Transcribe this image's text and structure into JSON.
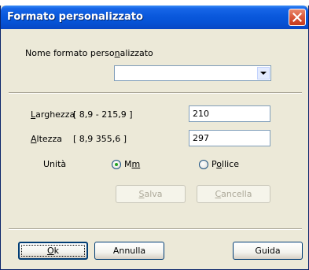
{
  "window": {
    "title": "Formato personalizzato"
  },
  "format_name": {
    "label_pre": "Nome formato perso",
    "label_accel": "n",
    "label_post": "alizzato",
    "value": ""
  },
  "width": {
    "label_accel": "L",
    "label_post": "arghezza",
    "range": "[ 8,9 -  215,9 ]",
    "value": "210"
  },
  "height": {
    "label_accel": "A",
    "label_post": "ltezza",
    "range": "[  8,9    355,6 ]",
    "value": "297"
  },
  "unit": {
    "label": "Unità",
    "options": [
      {
        "pre": "M",
        "accel": "m",
        "post": "",
        "selected": true
      },
      {
        "pre": "P",
        "accel": "o",
        "post": "llice",
        "selected": false
      }
    ]
  },
  "actions": {
    "save": {
      "accel": "S",
      "post": "alva",
      "enabled": false
    },
    "delete": {
      "accel": "C",
      "post": "ancella",
      "enabled": false
    }
  },
  "footer": {
    "ok": {
      "accel": "O",
      "post": "k"
    },
    "cancel": "Annulla",
    "help": "Guida"
  },
  "colors": {
    "titlebar": "#0653d6",
    "close": "#d9573a",
    "dialog_bg": "#ece9d8",
    "radio_dot": "#21a121"
  }
}
